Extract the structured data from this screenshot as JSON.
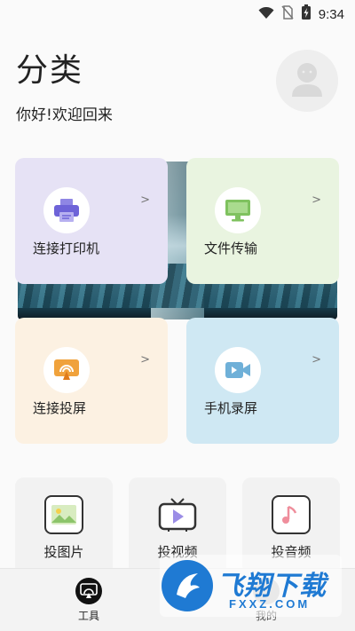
{
  "status_bar": {
    "time": "9:34",
    "icons": [
      "wifi-icon",
      "no-sim-icon",
      "battery-charging-icon"
    ]
  },
  "header": {
    "title": "分类",
    "greeting": "你好!欢迎回来",
    "avatar_icon": "user-avatar-icon"
  },
  "features": [
    {
      "label": "连接打印机",
      "icon": "printer-icon",
      "arrow": ">",
      "color": "#e6e2f5",
      "icon_color": "#6e63d8"
    },
    {
      "label": "文件传输",
      "icon": "monitor-icon",
      "arrow": ">",
      "color": "#e9f4e0",
      "icon_color": "#7fc25f"
    },
    {
      "label": "连接投屏",
      "icon": "cast-icon",
      "arrow": ">",
      "color": "#fcf1e2",
      "icon_color": "#f0a23c"
    },
    {
      "label": "手机录屏",
      "icon": "video-icon",
      "arrow": ">",
      "color": "#cfe8f3",
      "icon_color": "#6fb0d8"
    }
  ],
  "tools": [
    {
      "label": "投图片",
      "icon": "image-icon"
    },
    {
      "label": "投视频",
      "icon": "tv-play-icon"
    },
    {
      "label": "投音频",
      "icon": "music-icon"
    }
  ],
  "bottom_nav": [
    {
      "label": "工具",
      "icon": "tools-cast-icon",
      "active": true
    },
    {
      "label": "我的",
      "icon": "profile-icon",
      "active": false
    }
  ],
  "watermark": {
    "text": "飞翔下载",
    "sub": "FXXZ.COM"
  }
}
